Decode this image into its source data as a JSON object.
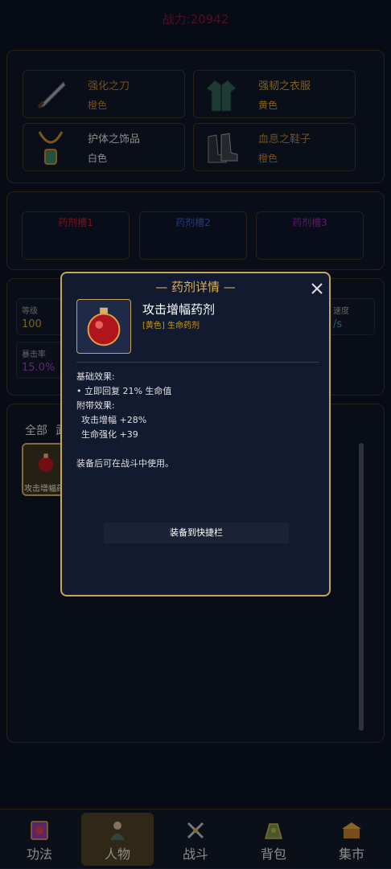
{
  "header": {
    "power": "战力:20942"
  },
  "equipment": [
    {
      "name": "强化之刀",
      "quality": "橙色",
      "name_color": "#b8771e",
      "quality_color": "#b8771e",
      "icon": "knife-icon"
    },
    {
      "name": "强韧之衣服",
      "quality": "黄色",
      "name_color": "#c8971a",
      "quality_color": "#c8971a",
      "icon": "robe-icon"
    },
    {
      "name": "护体之饰品",
      "quality": "白色",
      "name_color": "#d8d8d8",
      "quality_color": "#d8d8d8",
      "icon": "necklace-icon"
    },
    {
      "name": "血息之鞋子",
      "quality": "橙色",
      "name_color": "#b8771e",
      "quality_color": "#b8771e",
      "icon": "boots-icon"
    }
  ],
  "potion_slots": [
    {
      "label": "药剂槽1",
      "color": "#b0202c"
    },
    {
      "label": "药剂槽2",
      "color": "#3a5ab0"
    },
    {
      "label": "药剂槽3",
      "color": "#8a2a9a"
    }
  ],
  "stats": [
    {
      "label": "等级",
      "value": "100",
      "color": "#c8971a"
    },
    {
      "label": "速度",
      "value": "/s",
      "color": "#4a8a9a"
    },
    {
      "label": "暴击率",
      "value": "15.0%",
      "color": "#9a3ab8"
    }
  ],
  "inventory": {
    "tabs": [
      "全部",
      "武"
    ],
    "item": {
      "label": "攻击增幅药",
      "icon": "red-potion-icon"
    }
  },
  "modal": {
    "title": "— 药剂详情 —",
    "close_icon": "close-icon",
    "item_name": "攻击增幅药剂",
    "item_tag": "[黄色] 生命药剂",
    "base_header": "基础效果:",
    "base_effect": "• 立即回复 21% 生命值",
    "extra_header": "附带效果:",
    "extra_effects": [
      "攻击增幅 +28%",
      "生命强化 +39"
    ],
    "note": "装备后可在战斗中使用。",
    "equip_button": "装备到快捷栏"
  },
  "nav": [
    {
      "label": "功法",
      "icon": "scroll-book-icon",
      "active": false
    },
    {
      "label": "人物",
      "icon": "character-icon",
      "active": true
    },
    {
      "label": "战斗",
      "icon": "crossed-swords-icon",
      "active": false
    },
    {
      "label": "背包",
      "icon": "bag-icon",
      "active": false
    },
    {
      "label": "集市",
      "icon": "market-icon",
      "active": false
    }
  ],
  "colors": {
    "gold": "#c8a35a",
    "accent_power": "#8a1030"
  }
}
